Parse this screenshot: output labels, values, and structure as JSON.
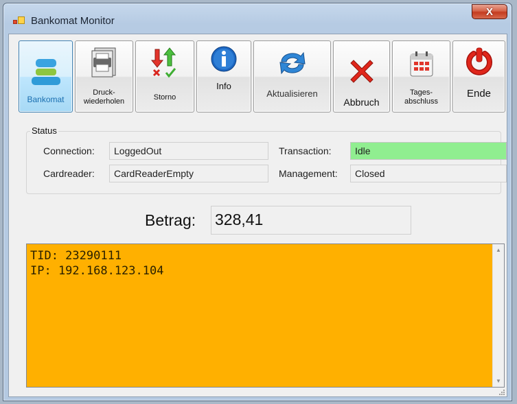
{
  "window": {
    "title": "Bankomat Monitor",
    "close_glyph": "X"
  },
  "toolbar": {
    "bankomat": {
      "label": "Bankomat",
      "icon": "bankomat-logo-icon"
    },
    "reprint": {
      "line1": "Druck-",
      "line2": "wiederholen",
      "icon": "printer-icon"
    },
    "storno": {
      "label": "Storno",
      "icon": "storno-arrows-icon"
    },
    "info": {
      "label": "Info",
      "icon": "info-icon"
    },
    "refresh": {
      "label": "Aktualisieren",
      "icon": "refresh-icon"
    },
    "abort": {
      "label": "Abbruch",
      "icon": "red-x-icon"
    },
    "closing": {
      "line1": "Tages-",
      "line2": "abschluss",
      "icon": "calendar-icon"
    },
    "end": {
      "label": "Ende",
      "icon": "power-icon"
    }
  },
  "status": {
    "title": "Status",
    "connection_label": "Connection:",
    "connection_value": "LoggedOut",
    "cardreader_label": "Cardreader:",
    "cardreader_value": "CardReaderEmpty",
    "transaction_label": "Transaction:",
    "transaction_value": "Idle",
    "management_label": "Management:",
    "management_value": "Closed",
    "colors": {
      "transaction_bg": "#90ee90"
    }
  },
  "amount": {
    "label": "Betrag:",
    "value": "328,41"
  },
  "log": {
    "lines": [
      "TID: 23290111",
      "IP: 192.168.123.104"
    ],
    "background": "#ffb000"
  }
}
